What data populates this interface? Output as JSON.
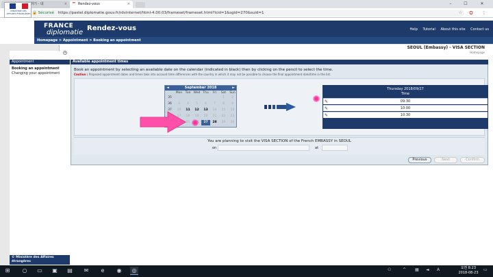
{
  "browser": {
    "tabs": [
      {
        "label": "비자 신청 예약하기 - 네",
        "active": false
      },
      {
        "label": "Rendez-vous",
        "active": true
      }
    ],
    "secure_label": "Sécurisé",
    "url": "https://pastel.diplomatie.gouv.fr/rdvinternet/html-4.00.03/frameset/frameset.html?lcid=1&sgid=270&suid=1",
    "window_controls": [
      "–",
      "☐",
      "✕"
    ]
  },
  "site": {
    "flag_text": "MINISTÈRE DES AFFAIRES ÉTRANGÈRES",
    "logo_france": "FRANCE",
    "logo_diplomatie": "diplomatie",
    "app_title": "Rendez-vous",
    "top_links": [
      "Help",
      "Tutorial",
      "About this site",
      "Contact us"
    ],
    "breadcrumb": "Homepage > Appointment > Booking an appointment",
    "embassy": "SEOUL (Embassy) - VISA SECTION",
    "homepage_link": "Homepage"
  },
  "left_panel": {
    "header": "Appointment",
    "items": [
      "Booking an appointment",
      "Changing your appointment"
    ],
    "footer": "© Ministère des Affaires étrangères"
  },
  "main": {
    "header": "Available appointment times",
    "instructions": "Book an appointment by selecting an available date on the calendar (indicated in black) then by clicking on the pencil to select the time.",
    "caution_label": "Caution :",
    "caution_text": "Proposed appointment dates and times take into account time differences with the country in which it may not be possible to choose the final appointment date/time in the list."
  },
  "calendar": {
    "title": "September 2018",
    "prev": "◄",
    "next": "►",
    "weekdays": [
      "Mon",
      "Tue",
      "Wed",
      "Thu",
      "Fri",
      "Sat",
      "Sun"
    ],
    "weeks": [
      {
        "wk": "35",
        "days": [
          "",
          "",
          "",
          "",
          "",
          "1",
          "2"
        ]
      },
      {
        "wk": "36",
        "days": [
          "3",
          "4",
          "5",
          "6",
          "7",
          "8",
          "9"
        ]
      },
      {
        "wk": "37",
        "days": [
          "10",
          "11",
          "12",
          "13",
          "14",
          "15",
          "16"
        ]
      },
      {
        "wk": "38",
        "days": [
          "17",
          "18",
          "19",
          "20",
          "21",
          "22",
          "23"
        ]
      },
      {
        "wk": "39",
        "days": [
          "24",
          "25",
          "26",
          "27",
          "28",
          "29",
          "30"
        ]
      }
    ],
    "available": [
      "11",
      "12",
      "13",
      "27",
      "28"
    ],
    "selected": "27"
  },
  "slots": {
    "day": "Thursday 2018/09/27",
    "time_label": "Time",
    "times": [
      "09:30",
      "10:00",
      "10:30"
    ]
  },
  "summary": {
    "text": "You are planning to visit the VISA SECTION of the French EMBASSY in SEOUL",
    "on_label": "on",
    "at_label": "at"
  },
  "buttons": {
    "previous": "Previous",
    "next": "Next",
    "confirm": "Confirm"
  },
  "taskbar": {
    "clock_time": "오전 8:23",
    "clock_date": "2018-08-23"
  },
  "colors": {
    "navy": "#1d3a6b",
    "highlight": "#ff2fa0",
    "arrow_pink": "#ff4fa8"
  }
}
